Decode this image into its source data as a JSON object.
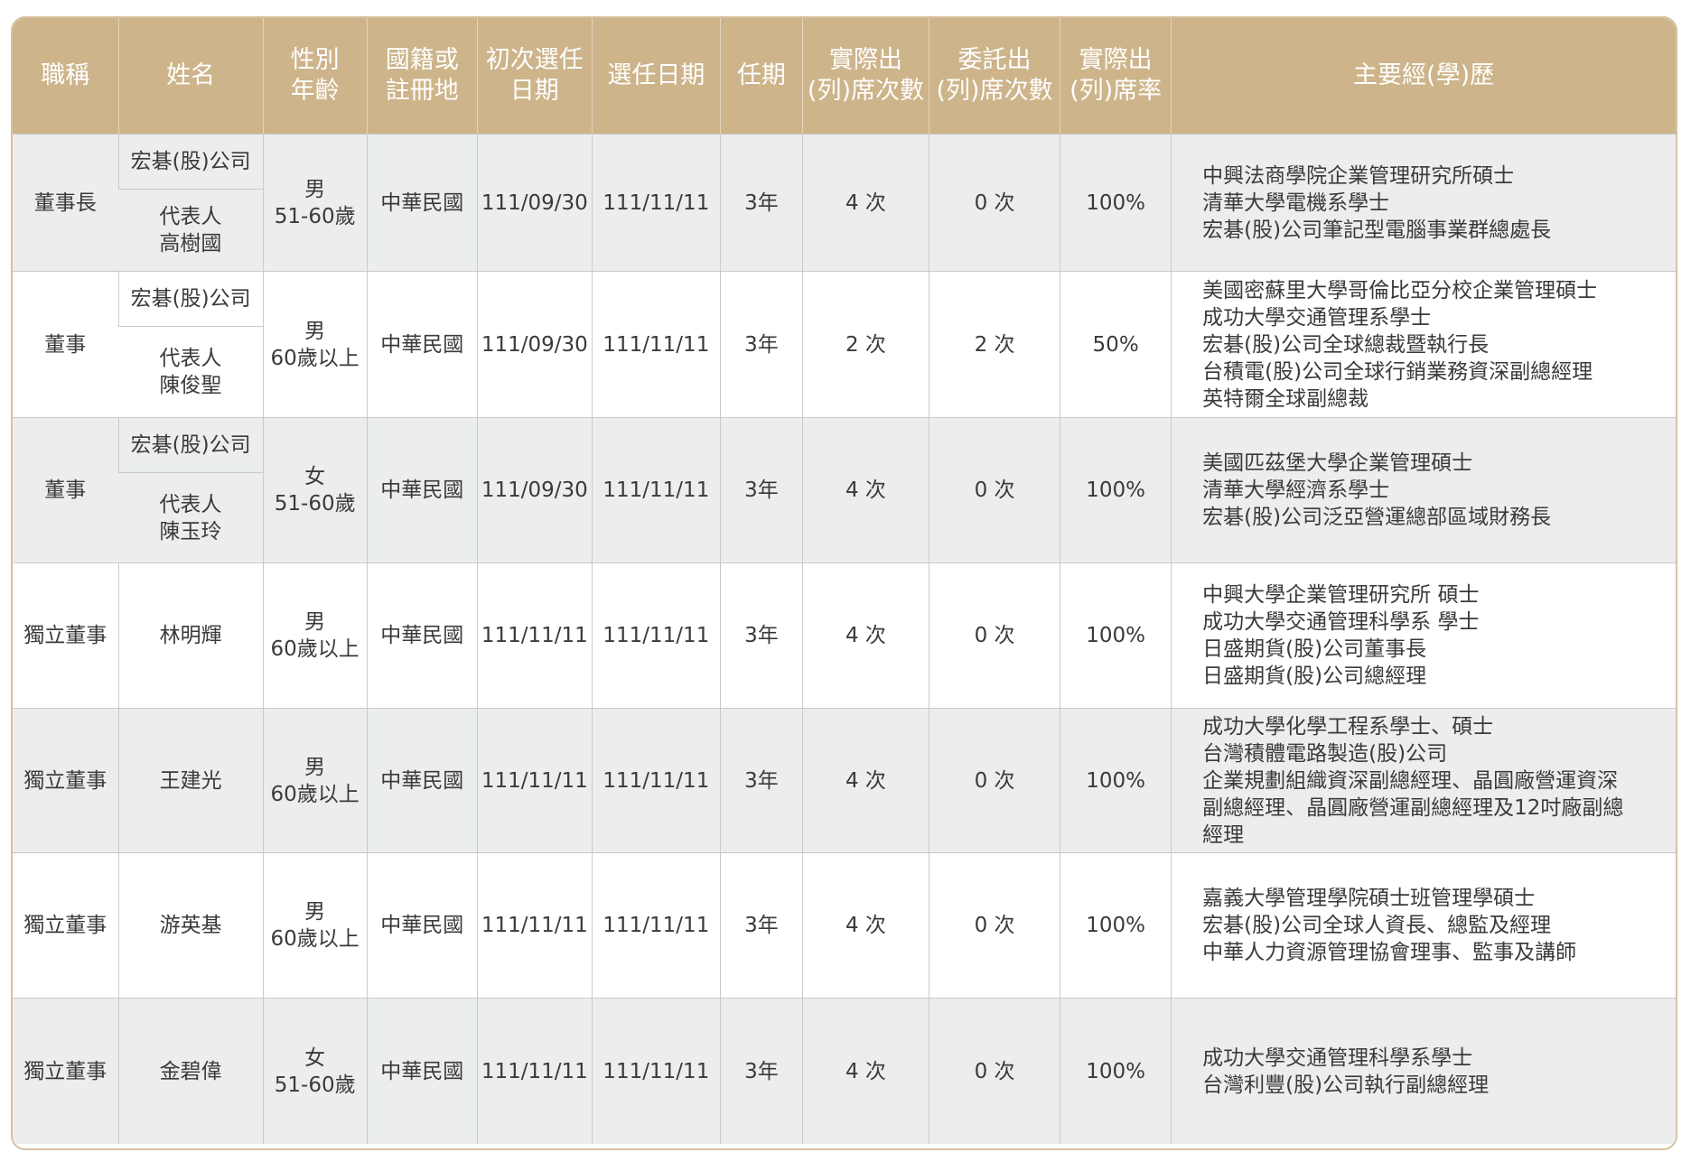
{
  "headers": {
    "title": "職稱",
    "name": "姓名",
    "gender_age": [
      "性別",
      "年齡"
    ],
    "nationality": [
      "國籍或",
      "註冊地"
    ],
    "first_elected": [
      "初次選任",
      "日期"
    ],
    "elected_date": "選任日期",
    "term": "任期",
    "actual_attendance": [
      "實際出",
      "(列)席次數"
    ],
    "proxy_attendance": [
      "委託出",
      "(列)席次數"
    ],
    "attendance_rate": [
      "實際出",
      "(列)席率"
    ],
    "experience": "主要經(學)歷"
  },
  "rows": [
    {
      "title": "董事長",
      "company": "宏碁(股)公司",
      "rep_label": "代表人",
      "rep_name": "高樹國",
      "gender": "男",
      "age": "51-60歲",
      "nationality": "中華民國",
      "first_elected": "111/09/30",
      "elected_date": "111/11/11",
      "term": "3年",
      "actual": "4 次",
      "proxy": "0 次",
      "rate": "100%",
      "experience": [
        "中興法商學院企業管理研究所碩士",
        "清華大學電機系學士",
        "宏碁(股)公司筆記型電腦事業群總處長"
      ]
    },
    {
      "title": "董事",
      "company": "宏碁(股)公司",
      "rep_label": "代表人",
      "rep_name": "陳俊聖",
      "gender": "男",
      "age": "60歲以上",
      "nationality": "中華民國",
      "first_elected": "111/09/30",
      "elected_date": "111/11/11",
      "term": "3年",
      "actual": "2 次",
      "proxy": "2 次",
      "rate": "50%",
      "experience": [
        "美國密蘇里大學哥倫比亞分校企業管理碩士",
        "成功大學交通管理系學士",
        "宏碁(股)公司全球總裁暨執行長",
        "台積電(股)公司全球行銷業務資深副總經理",
        "英特爾全球副總裁"
      ]
    },
    {
      "title": "董事",
      "company": "宏碁(股)公司",
      "rep_label": "代表人",
      "rep_name": "陳玉玲",
      "gender": "女",
      "age": "51-60歲",
      "nationality": "中華民國",
      "first_elected": "111/09/30",
      "elected_date": "111/11/11",
      "term": "3年",
      "actual": "4 次",
      "proxy": "0 次",
      "rate": "100%",
      "experience": [
        "美國匹茲堡大學企業管理碩士",
        "清華大學經濟系學士",
        "宏碁(股)公司泛亞營運總部區域財務長"
      ]
    },
    {
      "title": "獨立董事",
      "name": "林明輝",
      "gender": "男",
      "age": "60歲以上",
      "nationality": "中華民國",
      "first_elected": "111/11/11",
      "elected_date": "111/11/11",
      "term": "3年",
      "actual": "4 次",
      "proxy": "0 次",
      "rate": "100%",
      "experience": [
        "中興大學企業管理研究所 碩士",
        "成功大學交通管理科學系 學士",
        "日盛期貨(股)公司董事長",
        "日盛期貨(股)公司總經理"
      ]
    },
    {
      "title": "獨立董事",
      "name": "王建光",
      "gender": "男",
      "age": "60歲以上",
      "nationality": "中華民國",
      "first_elected": "111/11/11",
      "elected_date": "111/11/11",
      "term": "3年",
      "actual": "4 次",
      "proxy": "0 次",
      "rate": "100%",
      "experience": [
        "成功大學化學工程系學士、碩士",
        "台灣積體電路製造(股)公司",
        "企業規劃組織資深副總經理、晶圓廠營運資深",
        "副總經理、晶圓廠營運副總經理及12吋廠副總",
        "經理"
      ]
    },
    {
      "title": "獨立董事",
      "name": "游英基",
      "gender": "男",
      "age": "60歲以上",
      "nationality": "中華民國",
      "first_elected": "111/11/11",
      "elected_date": "111/11/11",
      "term": "3年",
      "actual": "4 次",
      "proxy": "0 次",
      "rate": "100%",
      "experience": [
        "嘉義大學管理學院碩士班管理學碩士",
        "宏碁(股)公司全球人資長、總監及經理",
        "中華人力資源管理協會理事、監事及講師"
      ]
    },
    {
      "title": "獨立董事",
      "name": "金碧偉",
      "gender": "女",
      "age": "51-60歲",
      "nationality": "中華民國",
      "first_elected": "111/11/11",
      "elected_date": "111/11/11",
      "term": "3年",
      "actual": "4 次",
      "proxy": "0 次",
      "rate": "100%",
      "experience": [
        "成功大學交通管理科學系學士",
        "台灣利豐(股)公司執行副總經理"
      ]
    }
  ]
}
